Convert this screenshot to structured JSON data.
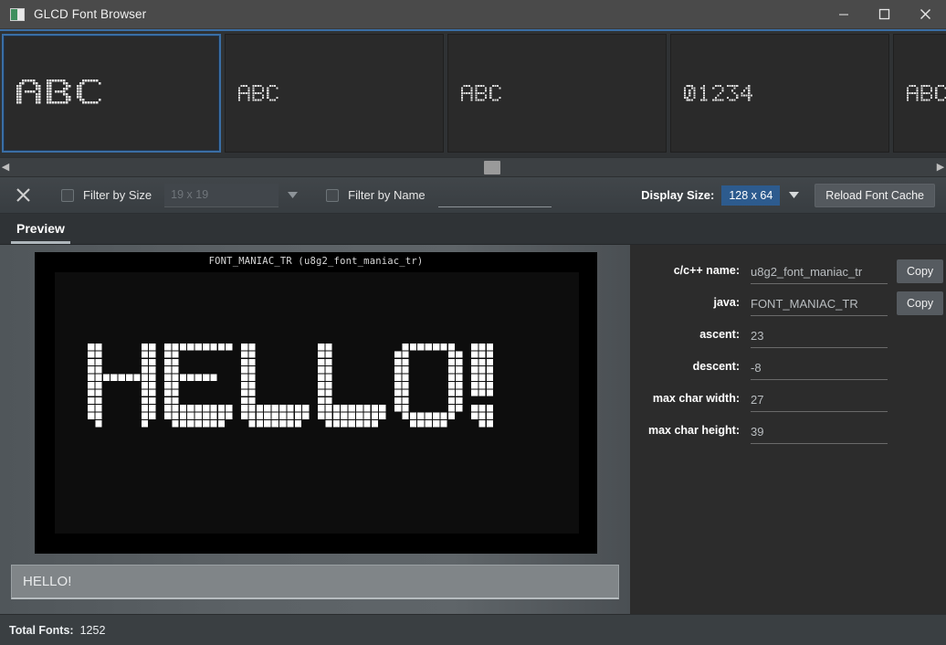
{
  "window": {
    "title": "GLCD Font Browser",
    "icon": "app-icon",
    "minimize": "minimize",
    "maximize": "maximize",
    "close": "close"
  },
  "thumbnails": [
    {
      "sample": "ABC",
      "selected": true,
      "style": "outline"
    },
    {
      "sample": "ABC",
      "selected": false,
      "style": "solid"
    },
    {
      "sample": "ABC",
      "selected": false,
      "style": "solid"
    },
    {
      "sample": "01234",
      "selected": false,
      "style": "solid"
    },
    {
      "sample": "ABC",
      "selected": false,
      "style": "solid"
    }
  ],
  "scrollbar": {
    "left_arrow": "◀",
    "right_arrow": "▶"
  },
  "toolbar": {
    "clear_icon": "close-icon",
    "filter_by_size_label": "Filter by Size",
    "filter_by_size_checked": false,
    "size_combo_value": "19 x 19",
    "filter_by_name_label": "Filter by Name",
    "filter_by_name_checked": false,
    "name_input_value": "",
    "name_input_placeholder": "",
    "display_size_label": "Display Size:",
    "display_size_value": "128 x 64",
    "reload_label": "Reload Font Cache",
    "accent": "#2d5b8e"
  },
  "tabs": [
    {
      "label": "Preview",
      "active": true
    }
  ],
  "preview": {
    "canvas_title": "FONT_MANIAC_TR (u8g2_font_maniac_tr)",
    "sample_text": "HELLO!",
    "input_value": "HELLO!"
  },
  "properties": [
    {
      "label": "c/c++ name:",
      "value": "u8g2_font_maniac_tr",
      "copy": "Copy"
    },
    {
      "label": "java:",
      "value": "FONT_MANIAC_TR",
      "copy": "Copy"
    },
    {
      "label": "ascent:",
      "value": "23",
      "copy": null
    },
    {
      "label": "descent:",
      "value": "-8",
      "copy": null
    },
    {
      "label": "max char width:",
      "value": "27",
      "copy": null
    },
    {
      "label": "max char height:",
      "value": "39",
      "copy": null
    }
  ],
  "status": {
    "total_fonts_label": "Total Fonts:",
    "total_fonts_value": "1252"
  }
}
